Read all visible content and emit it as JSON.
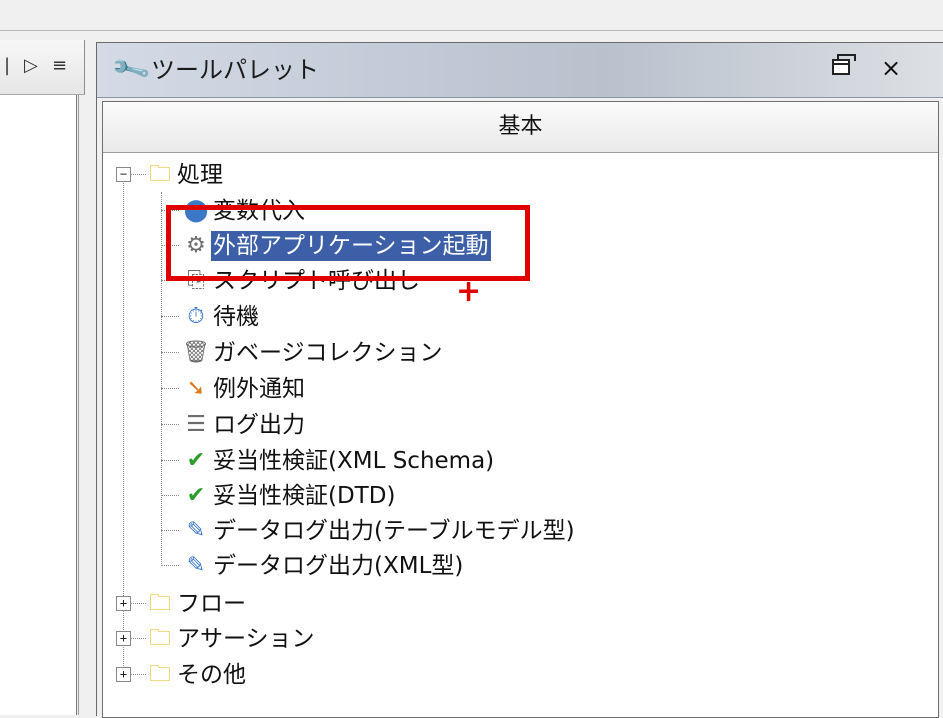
{
  "palette": {
    "title": "ツールパレット",
    "restore_icon": "restore-window-icon",
    "close_symbol": "×",
    "tab_label": "基本"
  },
  "left_pane": {
    "controls": [
      "▷",
      "≡"
    ]
  },
  "tree": {
    "root_folder": "処理",
    "items": [
      {
        "label": "変数代入",
        "icon": "variable-assign-icon"
      },
      {
        "label": "外部アプリケーション起動",
        "icon": "external-app-icon",
        "selected": true
      },
      {
        "label": "スクリプト呼び出し",
        "icon": "script-call-icon"
      },
      {
        "label": "待機",
        "icon": "clock-icon"
      },
      {
        "label": "ガベージコレクション",
        "icon": "trash-icon"
      },
      {
        "label": "例外通知",
        "icon": "exception-notify-icon"
      },
      {
        "label": "ログ出力",
        "icon": "log-output-icon"
      },
      {
        "label": "妥当性検証(XML Schema)",
        "icon": "checkmark-icon"
      },
      {
        "label": "妥当性検証(DTD)",
        "icon": "checkmark-icon"
      },
      {
        "label": "データログ出力(テーブルモデル型)",
        "icon": "data-log-table-icon"
      },
      {
        "label": "データログ出力(XML型)",
        "icon": "data-log-xml-icon"
      }
    ],
    "collapsed_folders": [
      "フロー",
      "アサーション",
      "その他"
    ],
    "expand_symbol": "+",
    "collapse_symbol": "−"
  },
  "colors": {
    "selection": "#3d5fa8",
    "highlight_box": "#e00000",
    "folder": "#e6b800"
  }
}
